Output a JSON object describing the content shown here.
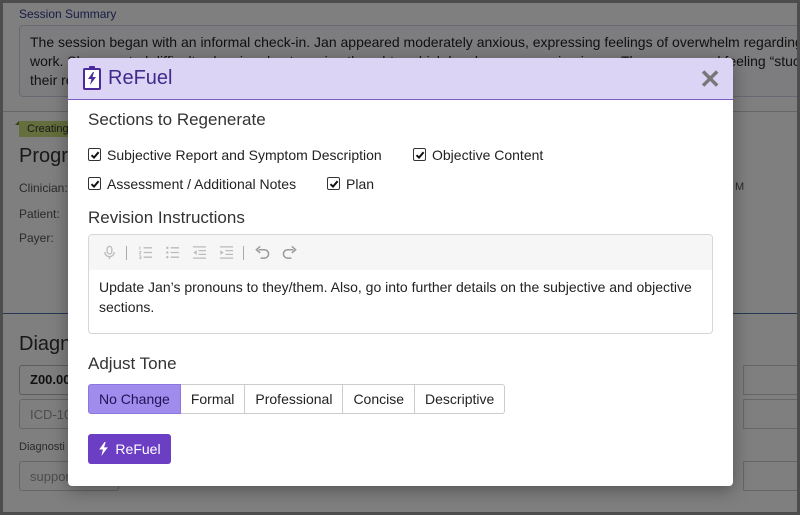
{
  "background": {
    "summary_label": "Session Summary",
    "summary_lines": [
      "The session began with an informal check-in. Jan appeared moderately anxious, expressing feelings of overwhelm regarding",
      "work. She reported difficulty sleeping due to racing thoughts, which has been a recurring issue. They expressed feeling “stuck”",
      "their re"
    ],
    "creating_badge": "Creating",
    "progress_heading": "Progre",
    "fields": [
      "Clinician:",
      "Patient:",
      "Payer:"
    ],
    "time_suffix": "M",
    "diagnosis_heading": "Diagno",
    "diagnosis_code": "Z00.00",
    "icd_placeholder": "ICD-10",
    "diagnosis_label": "Diagnosti",
    "support_placeholder": "suppor"
  },
  "modal": {
    "title": "ReFuel",
    "close_icon": "close-icon",
    "sections_title": "Sections to Regenerate",
    "sections": [
      {
        "label": "Subjective Report and Symptom Description",
        "checked": true
      },
      {
        "label": "Objective Content",
        "checked": true
      },
      {
        "label": "Assessment / Additional Notes",
        "checked": true
      },
      {
        "label": "Plan",
        "checked": true
      }
    ],
    "revision_title": "Revision Instructions",
    "toolbar_icons": [
      "microphone-icon",
      "ordered-list-icon",
      "unordered-list-icon",
      "outdent-icon",
      "indent-icon",
      "undo-icon",
      "redo-icon"
    ],
    "revision_text": "Update Jan’s pronouns to they/them. Also, go into further details on the subjective and objective sections.",
    "tone_title": "Adjust Tone",
    "tones": [
      "No Change",
      "Formal",
      "Professional",
      "Concise",
      "Descriptive"
    ],
    "selected_tone": "No Change",
    "submit_label": "ReFuel"
  },
  "colors": {
    "header_bg": "#dcd4f4",
    "accent": "#6b3ec3",
    "selected_tone_bg": "#a08cec"
  }
}
